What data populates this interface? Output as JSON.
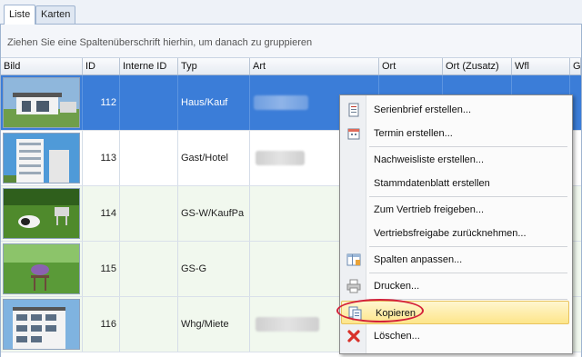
{
  "tabs": [
    {
      "label": "Liste",
      "active": true
    },
    {
      "label": "Karten",
      "active": false
    }
  ],
  "group_hint": "Ziehen Sie eine Spaltenüberschrift hierhin, um danach zu gruppieren",
  "columns": [
    "Bild",
    "ID",
    "Interne ID",
    "Typ",
    "Art",
    "Ort",
    "Ort (Zusatz)",
    "Wfl",
    "Gr"
  ],
  "rows": [
    {
      "id": "112",
      "typ": "Haus/Kauf",
      "selected": true
    },
    {
      "id": "113",
      "typ": "Gast/Hotel",
      "selected": false
    },
    {
      "id": "114",
      "typ": "GS-W/KaufPa",
      "selected": false
    },
    {
      "id": "115",
      "typ": "GS-G",
      "selected": false
    },
    {
      "id": "116",
      "typ": "Whg/Miete",
      "selected": false
    }
  ],
  "context_menu": {
    "items": [
      {
        "label": "Serienbrief erstellen...",
        "icon": "document-icon"
      },
      {
        "label": "Termin erstellen...",
        "icon": "calendar-icon"
      },
      {
        "label": "Nachweisliste erstellen...",
        "icon": ""
      },
      {
        "label": "Stammdatenblatt erstellen",
        "icon": ""
      },
      {
        "label": "Zum Vertrieb freigeben...",
        "icon": ""
      },
      {
        "label": "Vertriebsfreigabe zurücknehmen...",
        "icon": ""
      },
      {
        "label": "Spalten anpassen...",
        "icon": "columns-icon"
      },
      {
        "label": "Drucken...",
        "icon": "printer-icon"
      },
      {
        "label": "Kopieren",
        "icon": "copy-icon",
        "highlighted": true
      },
      {
        "label": "Löschen...",
        "icon": "delete-icon"
      }
    ]
  },
  "colors": {
    "selection": "#3b7dd8",
    "alt_row": "#f1f8ee",
    "highlight_ring": "#d4213a"
  }
}
